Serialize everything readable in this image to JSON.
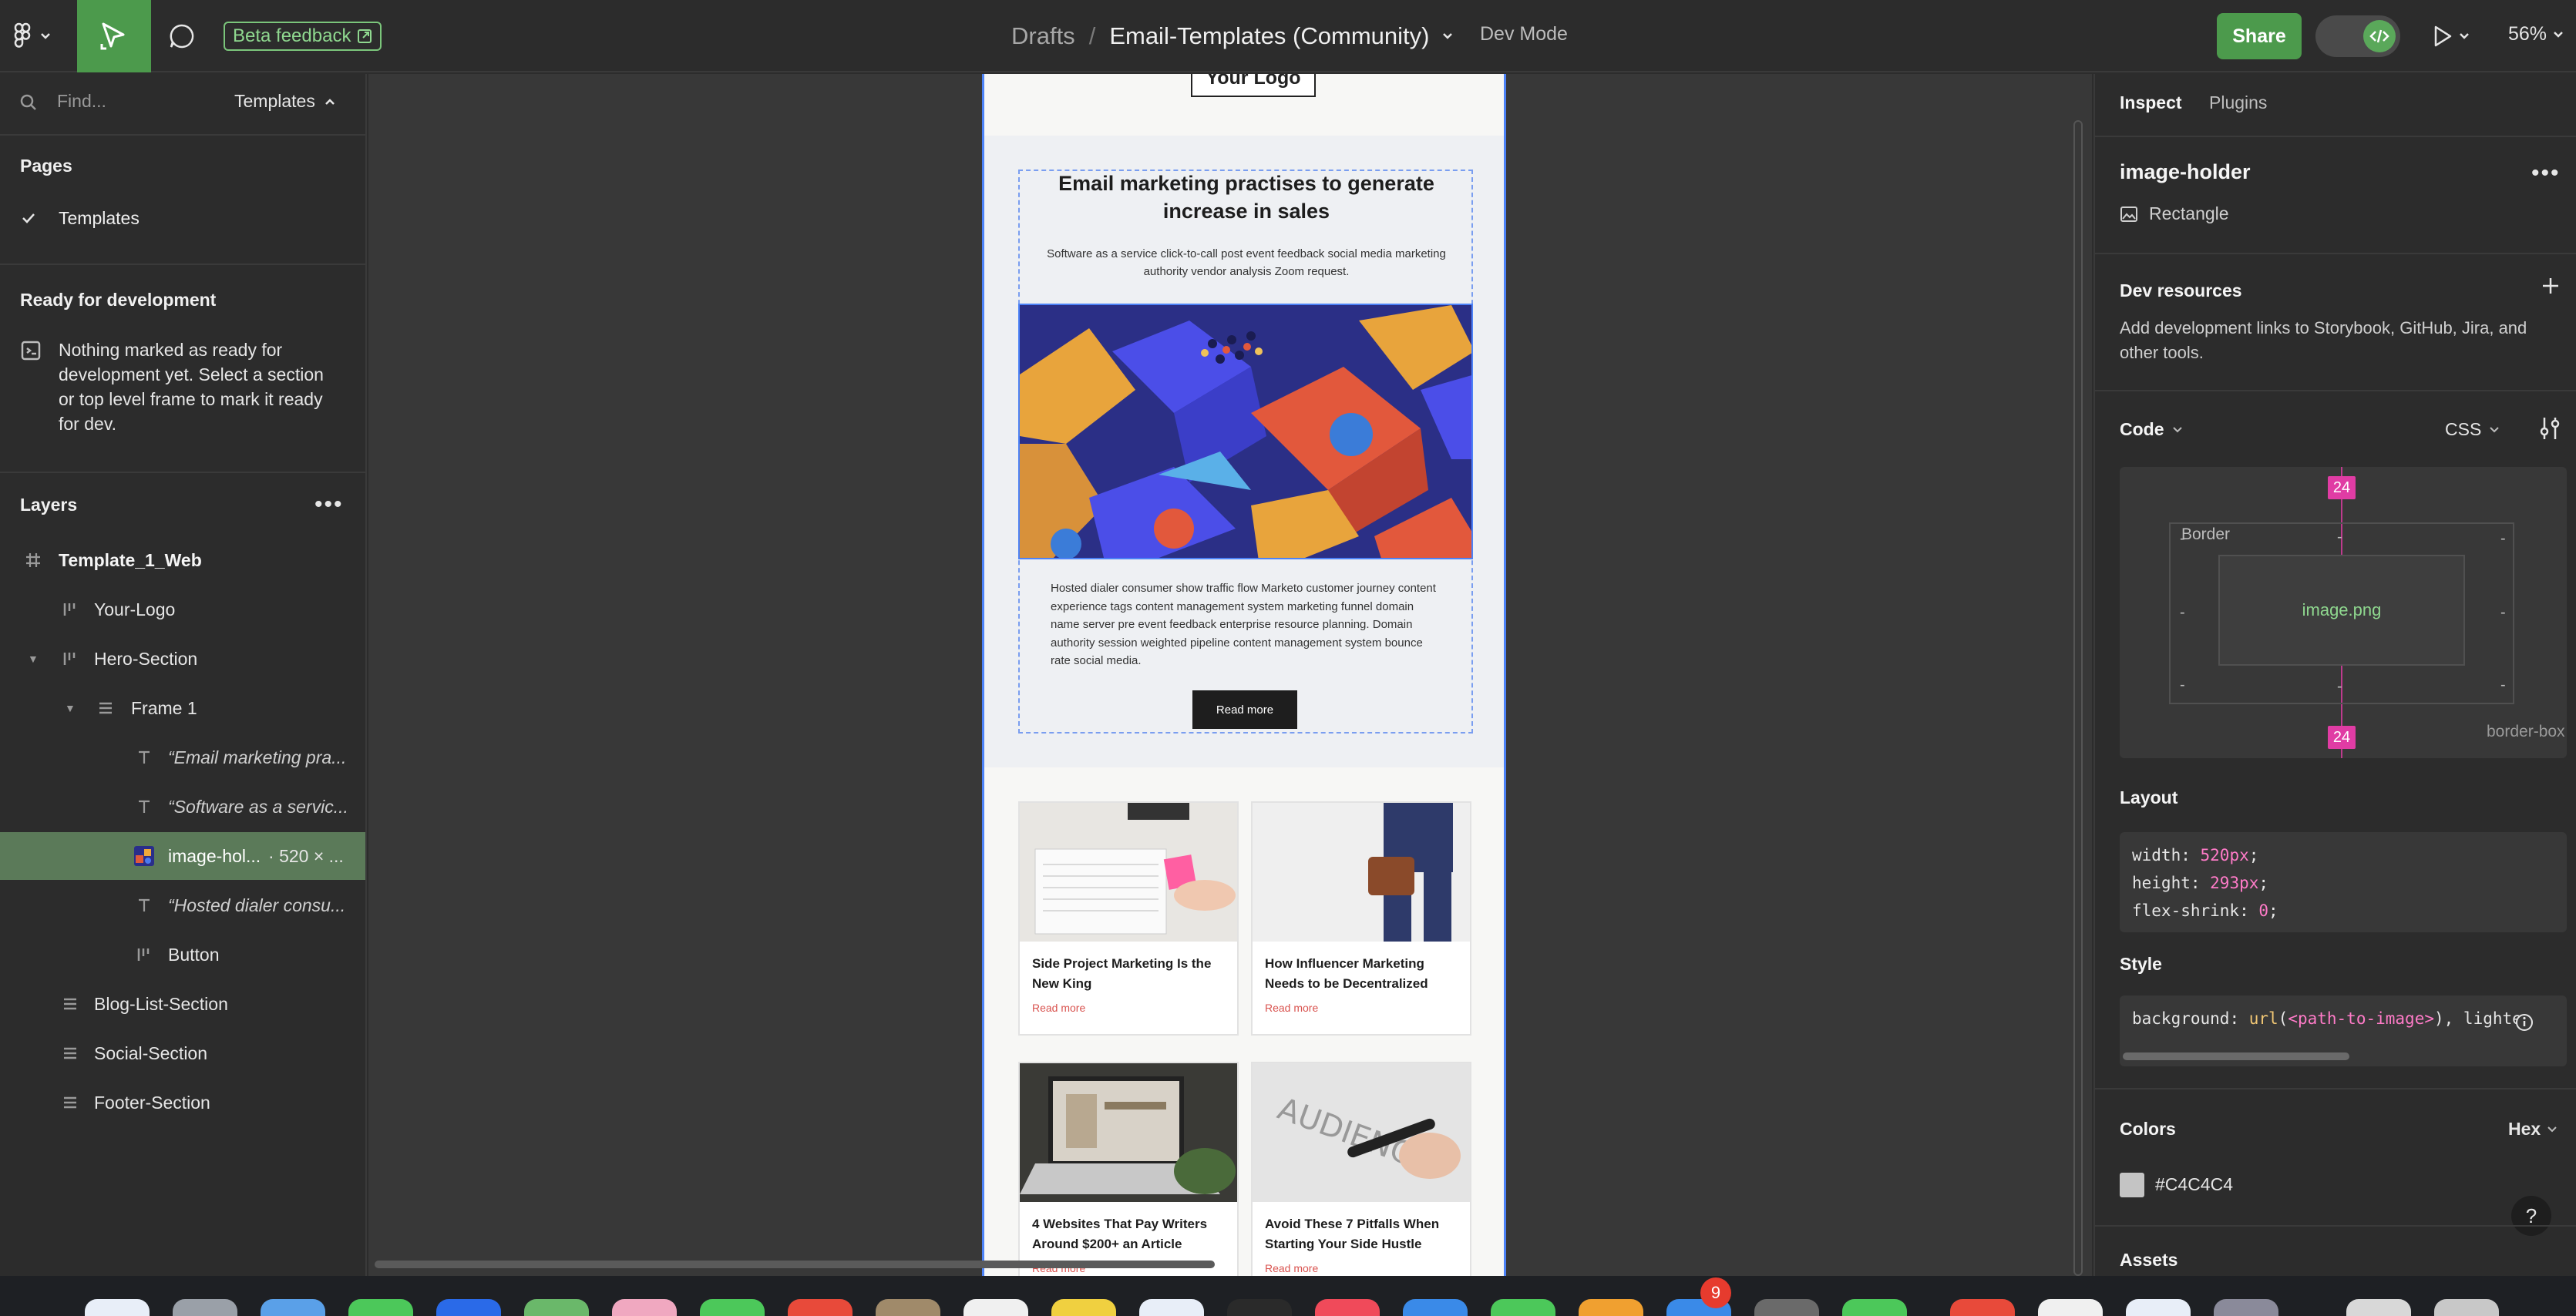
{
  "toolbar": {
    "beta_feedback": "Beta feedback",
    "breadcrumb_drafts": "Drafts",
    "breadcrumb_sep": "/",
    "file_name": "Email-Templates (Community)",
    "dev_mode": "Dev Mode",
    "share": "Share",
    "zoom": "56%"
  },
  "left_panel": {
    "find_placeholder": "Find...",
    "templates_select": "Templates",
    "pages_heading": "Pages",
    "pages": [
      {
        "label": "Templates",
        "selected": true
      }
    ],
    "ready_heading": "Ready for development",
    "ready_text": "Nothing marked as ready for development yet. Select a section or top level frame to mark it ready for dev.",
    "layers_heading": "Layers",
    "layers": [
      {
        "label": "Template_1_Web",
        "icon": "frame-icon",
        "bold": true
      },
      {
        "label": "Your-Logo",
        "icon": "auto-layout-icon"
      },
      {
        "label": "Hero-Section",
        "icon": "auto-layout-icon"
      },
      {
        "label": "Frame 1",
        "icon": "vertical-layout-icon"
      },
      {
        "label": "“Email marketing pra...",
        "icon": "text-icon"
      },
      {
        "label": "“Software as a servic...",
        "icon": "text-icon"
      },
      {
        "label": "image-hol...",
        "size": "520 × ...",
        "icon": "image-icon",
        "selected": true
      },
      {
        "label": "“Hosted dialer consu...",
        "icon": "text-icon"
      },
      {
        "label": "Button",
        "icon": "auto-layout-icon"
      },
      {
        "label": "Blog-List-Section",
        "icon": "vertical-layout-icon"
      },
      {
        "label": "Social-Section",
        "icon": "vertical-layout-icon"
      },
      {
        "label": "Footer-Section",
        "icon": "vertical-layout-icon"
      }
    ]
  },
  "email": {
    "logo": "Your Logo",
    "hero_title": "Email marketing practises to generate increase in sales",
    "hero_sub": "Software as a service click-to-call post event feedback social media marketing authority vendor analysis Zoom request.",
    "hero_body": "Hosted dialer consumer show traffic flow Marketo customer journey content experience tags content management system marketing funnel domain name server pre event feedback enterprise resource planning. Domain authority session weighted pipeline content management system bounce rate social media.",
    "hero_button": "Read more",
    "cards": [
      {
        "title": "Side Project Marketing Is the New King",
        "more": "Read more"
      },
      {
        "title": "How Influencer Marketing Needs to be Decentralized",
        "more": "Read more"
      },
      {
        "title": "4 Websites That Pay Writers Around $200+ an Article",
        "more": "Read more"
      },
      {
        "title": "Avoid These 7 Pitfalls When Starting Your Side Hustle",
        "more": "Read more"
      }
    ]
  },
  "right_panel": {
    "tab_inspect": "Inspect",
    "tab_plugins": "Plugins",
    "layer_name": "image-holder",
    "layer_type": "Rectangle",
    "devres_heading": "Dev resources",
    "devres_desc": "Add development links to Storybook, GitHub, Jira, and other tools.",
    "code_heading": "Code",
    "code_lang": "CSS",
    "box_model": {
      "padding_top": "24",
      "padding_bottom": "24",
      "border_label": "Border",
      "content": "image.png",
      "dash": "-",
      "box_sizing": "border-box"
    },
    "layout_heading": "Layout",
    "layout_code": [
      {
        "prop": "width",
        "value": "520px"
      },
      {
        "prop": "height",
        "value": "293px"
      },
      {
        "prop": "flex-shrink",
        "value": "0"
      }
    ],
    "style_heading": "Style",
    "style_code": {
      "prop": "background",
      "fn": "url",
      "arg": "<path-to-image>",
      "rest": ", lighte"
    },
    "colors_heading": "Colors",
    "colors_format": "Hex",
    "color_value": "#C4C4C4",
    "help": "?",
    "assets_heading": "Assets"
  },
  "dock": {
    "badge": "9"
  },
  "colors": {
    "accent_green": "#4c9a4c",
    "selection_blue": "#4c82f7",
    "padding_pink": "#e03ca4"
  }
}
